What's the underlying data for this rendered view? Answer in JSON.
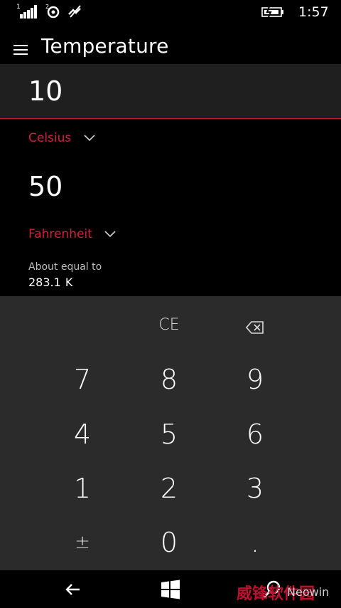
{
  "status_bar": {
    "sim_index": "1",
    "icons": [
      "signal-icon",
      "sim2-sync-icon",
      "no-network-icon",
      "battery-charging-icon"
    ],
    "time": "1:57"
  },
  "header": {
    "menu_icon": "hamburger-icon",
    "title": "Temperature"
  },
  "converter": {
    "input_value": "10",
    "from_unit": "Celsius",
    "output_value": "50",
    "to_unit": "Fahrenheit",
    "about_label": "About equal to",
    "about_value": "283.1",
    "about_unit": "K",
    "accent_color": "#d0203a"
  },
  "keypad": {
    "ce": "CE",
    "backspace_icon": "backspace-icon",
    "digits": [
      "7",
      "8",
      "9",
      "4",
      "5",
      "6",
      "1",
      "2",
      "3"
    ],
    "plus_minus": "±",
    "zero": "0",
    "decimal": "."
  },
  "navigation": {
    "back_icon": "back-arrow-icon",
    "start_icon": "windows-start-icon",
    "search_icon": "search-icon"
  },
  "watermark": {
    "text_cn": "威锋软件园",
    "text_en": "Neowin"
  }
}
